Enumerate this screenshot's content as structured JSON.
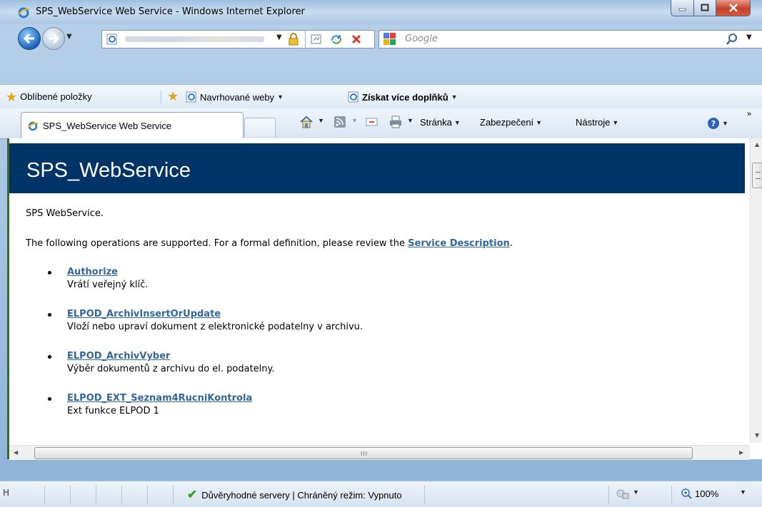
{
  "window": {
    "title": "SPS_WebService Web Service - Windows Internet Explorer"
  },
  "addressbar": {
    "search_placeholder": "Google"
  },
  "favorites": {
    "favorites_label": "Oblíbené položky",
    "suggested_sites": "Navrhované weby",
    "more_addons": "Získat více doplňků"
  },
  "tabs": {
    "active_label": "SPS_WebService Web Service"
  },
  "commandbar": {
    "page": "Stránka",
    "safety": "Zabezpečení",
    "tools": "Nástroje",
    "overflow": "»"
  },
  "page": {
    "header_title": "SPS_WebService",
    "intro": "SPS WebService.",
    "desc_prefix": "The following operations are supported. For a formal definition, please review the ",
    "desc_link": "Service Description",
    "desc_suffix": ".",
    "operations": [
      {
        "name": "Authorize",
        "description": "Vrátí veřejný klíč."
      },
      {
        "name": "ELPOD_ArchivInsertOrUpdate",
        "description": "Vloží nebo upraví dokument z elektronické podatelny v archivu."
      },
      {
        "name": "ELPOD_ArchivVyber",
        "description": "Výběr dokumentů z archivu do el. podatelny."
      },
      {
        "name": "ELPOD_EXT_Seznam4RucniKontrola",
        "description": "Ext funkce ELPOD 1"
      }
    ]
  },
  "scrollbar": {
    "grip": "III"
  },
  "statusbar": {
    "left_char": "H",
    "zone_text": "Důvěryhodné servery | Chráněný režim: Vypnuto",
    "zoom": "100%"
  },
  "colors": {
    "header_bg": "#003366",
    "link": "#336699",
    "close_button": "#c3412a"
  }
}
